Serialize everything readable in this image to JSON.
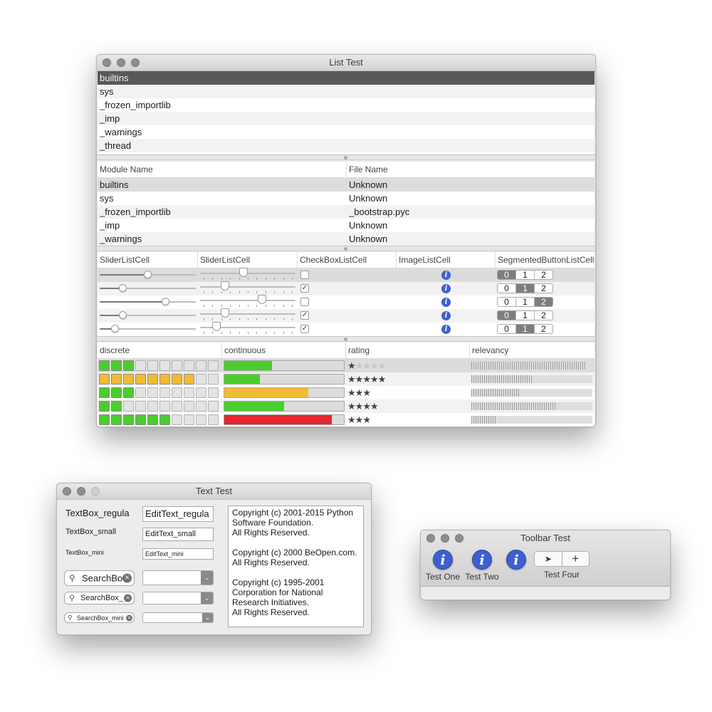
{
  "list_window": {
    "title": "List Test",
    "simple_list": [
      "builtins",
      "sys",
      "_frozen_importlib",
      "_imp",
      "_warnings",
      "_thread"
    ],
    "module_table": {
      "headers": [
        "Module Name",
        "File Name"
      ],
      "rows": [
        [
          "builtins",
          "Unknown"
        ],
        [
          "sys",
          "Unknown"
        ],
        [
          "_frozen_importlib",
          "_bootstrap.pyc"
        ],
        [
          "_imp",
          "Unknown"
        ],
        [
          "_warnings",
          "Unknown"
        ]
      ]
    },
    "cells_table": {
      "headers": [
        "SliderListCell",
        "SliderListCell",
        "CheckBoxListCell",
        "ImageListCell",
        "SegmentedButtonListCell"
      ],
      "rows": [
        {
          "slider1": 0.5,
          "slider2": 0.45,
          "checked": false,
          "icon": "info-icon",
          "segment": 0
        },
        {
          "slider1": 0.22,
          "slider2": 0.24,
          "checked": true,
          "icon": "info-icon",
          "segment": 1
        },
        {
          "slider1": 0.7,
          "slider2": 0.66,
          "checked": false,
          "icon": "info-icon",
          "segment": 2
        },
        {
          "slider1": 0.22,
          "slider2": 0.24,
          "checked": true,
          "icon": "info-icon",
          "segment": 0
        },
        {
          "slider1": 0.13,
          "slider2": 0.14,
          "checked": true,
          "icon": "info-icon",
          "segment": 1
        }
      ],
      "segment_labels": [
        "0",
        "1",
        "2"
      ],
      "checkmark": "✓",
      "info_glyph": "i"
    },
    "levels_table": {
      "headers": [
        "discrete",
        "continuous",
        "rating",
        "relevancy"
      ],
      "rows": [
        {
          "discrete": 3,
          "discrete_color": "#4ccd2e",
          "continuous": 0.4,
          "continuous_color": "#4ccd2e",
          "rating": 1,
          "relevancy": 0.95
        },
        {
          "discrete": 8,
          "discrete_color": "#f2bb35",
          "continuous": 0.3,
          "continuous_color": "#4ccd2e",
          "rating": 5,
          "relevancy": 0.5
        },
        {
          "discrete": 3,
          "discrete_color": "#4ccd2e",
          "continuous": 0.7,
          "continuous_color": "#f2bb35",
          "rating": 3,
          "relevancy": 0.4
        },
        {
          "discrete": 2,
          "discrete_color": "#4ccd2e",
          "continuous": 0.5,
          "continuous_color": "#4ccd2e",
          "rating": 4,
          "relevancy": 0.7
        },
        {
          "discrete": 6,
          "discrete_color": "#4ccd2e",
          "continuous": 0.9,
          "continuous_color": "#e5262d",
          "rating": 3,
          "relevancy": 0.2
        }
      ],
      "discrete_max": 10,
      "rating_max": 5,
      "star": "★"
    }
  },
  "text_window": {
    "title": "Text Test",
    "textbox_regular": "TextBox_regula",
    "textbox_small": "TextBox_small",
    "textbox_mini": "TextBox_mini",
    "edit_regular": "EditText_regula",
    "edit_small": "EditText_small",
    "edit_mini": "EditText_mini",
    "search_regular": "SearchBo",
    "search_small": "SearchBox_",
    "search_mini": "SearchBox_mini",
    "search_glyph": "⚲",
    "clear_glyph": "×",
    "combo_arrow": "⌄",
    "textview": [
      "Copyright (c) 2001-2015 Python Software Foundation.",
      "All Rights Reserved.",
      "",
      "Copyright (c) 2000 BeOpen.com.",
      "All Rights Reserved.",
      "",
      "Copyright (c) 1995-2001 Corporation for National Research Initiatives.",
      "All Rights Reserved."
    ]
  },
  "toolbar_window": {
    "title": "Toolbar Test",
    "items": [
      {
        "label": "Test One",
        "icon": "info-icon"
      },
      {
        "label": "Test Two",
        "icon": "info-icon"
      },
      {
        "label": "",
        "icon": "info-icon"
      },
      {
        "label": "Test Four",
        "icon": "segmented-control"
      }
    ],
    "segment_glyphs": [
      "➤",
      "+"
    ]
  }
}
